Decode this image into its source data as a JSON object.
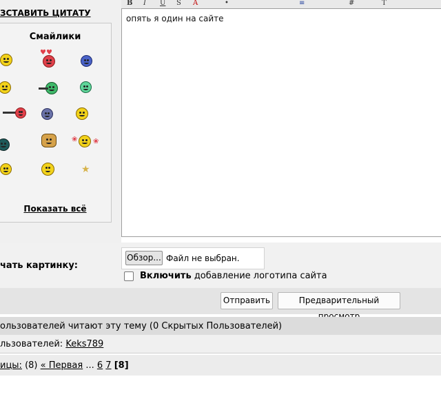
{
  "left_panel": {
    "quote_label": "ЗСТАВИТЬ ЦИТАТУ",
    "smilies_title": "Смайлики",
    "show_all": "Показать всё"
  },
  "toolbar": {
    "buttons": [
      "B",
      "I",
      "U",
      "S",
      "A",
      "•",
      "≡",
      "#",
      "T"
    ]
  },
  "editor": {
    "text": "опять я один на сайте"
  },
  "attach": {
    "label": "чать картинку:",
    "browse_label": "Обзор...",
    "file_status": "Файл не выбран.",
    "checkbox_bold": "Включить",
    "checkbox_rest": " добавление логотипа сайта"
  },
  "actions": {
    "submit": "Отправить",
    "preview": "Предварительный просмотр"
  },
  "info": {
    "reading": "ользователей читают эту тему (0 Скрытых Пользователей)",
    "users_prefix": "льзователей: ",
    "user_link": "Keks789"
  },
  "pager": {
    "label": "ицы:",
    "count": " (8) ",
    "first": "« Первая",
    "ellipsis": " ... ",
    "p6": "6",
    "p7": "7",
    "current": "[8]"
  },
  "colors": {
    "smiley_yellow": "#f2d21a",
    "smiley_red": "#e0404a",
    "smiley_green": "#3fb86a",
    "smiley_blue": "#4a63c8"
  }
}
